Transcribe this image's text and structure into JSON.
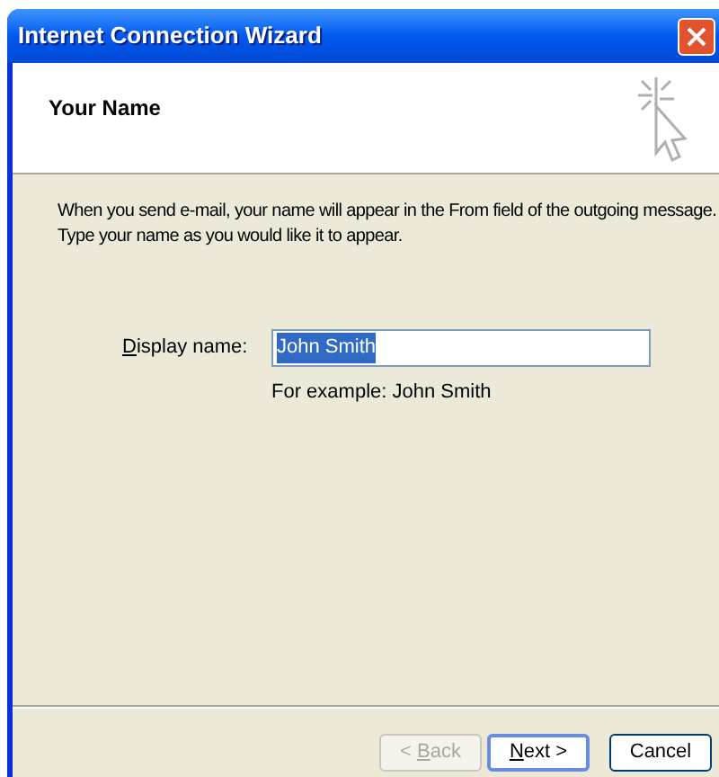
{
  "window": {
    "title": "Internet Connection Wizard"
  },
  "header": {
    "title": "Your Name"
  },
  "description": [
    "When you send e-mail, your name will appear in the From field of the outgoing message.",
    "Type your name as you would like it to appear."
  ],
  "display_name": {
    "label": {
      "key": "D",
      "rest": "isplay name:"
    },
    "value": "John Smith",
    "selected": true
  },
  "example": "For example: John Smith",
  "buttons": [
    {
      "label": {
        "before": "< ",
        "key": "B",
        "rest": "ack"
      },
      "disabled": true,
      "default": false
    },
    {
      "label": {
        "key": "N",
        "rest": "ext >"
      },
      "disabled": false,
      "default": true
    },
    {
      "label": {
        "rest": "Cancel"
      },
      "disabled": false,
      "default": false
    }
  ]
}
